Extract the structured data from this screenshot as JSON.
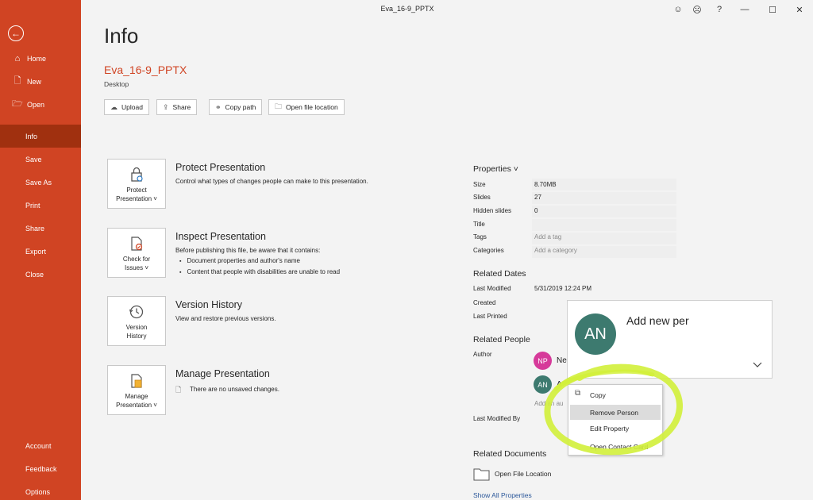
{
  "window": {
    "title": "Eva_16-9_PPTX",
    "controls": [
      "☺",
      "☹",
      "?",
      "—",
      "☐",
      "✕"
    ]
  },
  "sidebar": {
    "items": [
      {
        "label": "Home",
        "icon": "home-icon"
      },
      {
        "label": "New",
        "icon": "new-document-icon"
      },
      {
        "label": "Open",
        "icon": "folder-open-icon"
      },
      {
        "label": "Info"
      },
      {
        "label": "Save"
      },
      {
        "label": "Save As"
      },
      {
        "label": "Print"
      },
      {
        "label": "Share"
      },
      {
        "label": "Export"
      },
      {
        "label": "Close"
      }
    ],
    "bottom_items": [
      {
        "label": "Account"
      },
      {
        "label": "Feedback"
      },
      {
        "label": "Options"
      }
    ],
    "active": "Info",
    "accent": "#d04423"
  },
  "main": {
    "title": "Info",
    "doc_name": "Eva_16-9_PPTX",
    "doc_location": "Desktop",
    "actions": [
      {
        "label": "Upload",
        "icon": "upload-icon"
      },
      {
        "label": "Share",
        "icon": "share-icon"
      },
      {
        "label": "Copy path",
        "icon": "link-icon"
      },
      {
        "label": "Open file location",
        "icon": "folder-icon"
      }
    ],
    "sections": {
      "protect": {
        "button_line1": "Protect",
        "button_line2": "Presentation ˅",
        "title": "Protect Presentation",
        "desc": "Control what types of changes people can make to this presentation."
      },
      "inspect": {
        "button_line1": "Check for",
        "button_line2": "Issues ˅",
        "title": "Inspect Presentation",
        "desc": "Before publishing this file, be aware that it contains:",
        "bullets": [
          "Document properties and author's name",
          "Content that people with disabilities are unable to read"
        ]
      },
      "version": {
        "button_line1": "Version",
        "button_line2": "History",
        "title": "Version History",
        "desc": "View and restore previous versions."
      },
      "manage": {
        "button_line1": "Manage",
        "button_line2": "Presentation ˅",
        "title": "Manage Presentation",
        "desc": "There are no unsaved changes."
      }
    }
  },
  "properties": {
    "header": "Properties ˅",
    "rows": [
      {
        "label": "Size",
        "value": "8.70MB"
      },
      {
        "label": "Slides",
        "value": "27"
      },
      {
        "label": "Hidden slides",
        "value": "0"
      },
      {
        "label": "Title",
        "value": ""
      },
      {
        "label": "Tags",
        "value": "Add a tag"
      },
      {
        "label": "Categories",
        "value": "Add a category"
      }
    ],
    "related_dates": {
      "header": "Related Dates",
      "last_modified_label": "Last Modified",
      "last_modified_value": "5/31/2019 12:24 PM",
      "created_label": "Created",
      "last_printed_label": "Last Printed"
    },
    "related_people": {
      "header": "Related People",
      "author_label": "Author",
      "author1_initials": "NP",
      "author1_name": "Ne",
      "author2_initials": "AN",
      "author2_name": "A",
      "add_author": "Add an au",
      "last_modified_by_label": "Last Modified By"
    },
    "related_documents": {
      "header": "Related Documents",
      "open_location": "Open File Location",
      "show_all": "Show All Properties"
    }
  },
  "person_card": {
    "initials": "AN",
    "name": "Add new per",
    "avatar_color": "#3d7a6f"
  },
  "context_menu": {
    "items": [
      {
        "label": "Copy"
      },
      {
        "label": "Remove Person"
      },
      {
        "label": "Edit Property"
      },
      {
        "label": "Open Contact Card"
      }
    ],
    "highlighted": "Remove Person"
  },
  "annotation": {
    "color": "#d2f03a"
  }
}
